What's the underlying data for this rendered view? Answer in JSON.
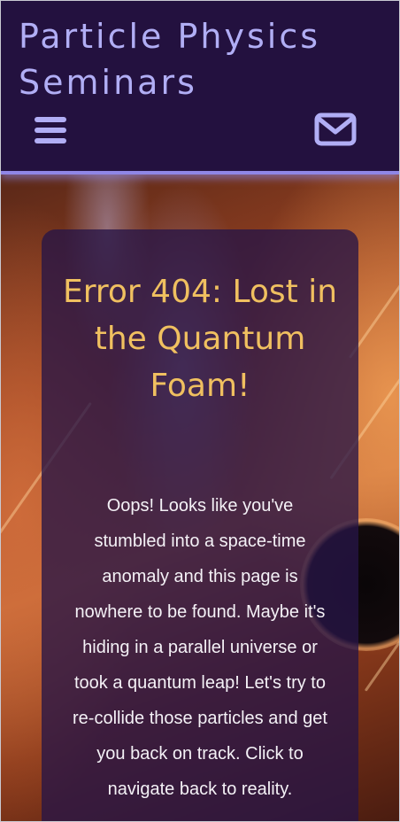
{
  "header": {
    "site_title": "Particle Physics Seminars",
    "menu_icon": "hamburger-menu-icon",
    "contact_icon": "envelope-icon"
  },
  "error_card": {
    "title": "Error 404: Lost in the Quantum Foam!",
    "message": "Oops! Looks like you've stumbled into a space-time anomaly and this page is nowhere to be found. Maybe it's hiding in a parallel universe or took a quantum leap! Let's try to re-collide those particles and get you back on track. Click to navigate back to reality."
  },
  "colors": {
    "header_bg": "#23113f",
    "header_border": "#8f86e6",
    "title_text": "#b1aef5",
    "card_title": "#f0c060",
    "card_text": "#f4f1f6"
  }
}
